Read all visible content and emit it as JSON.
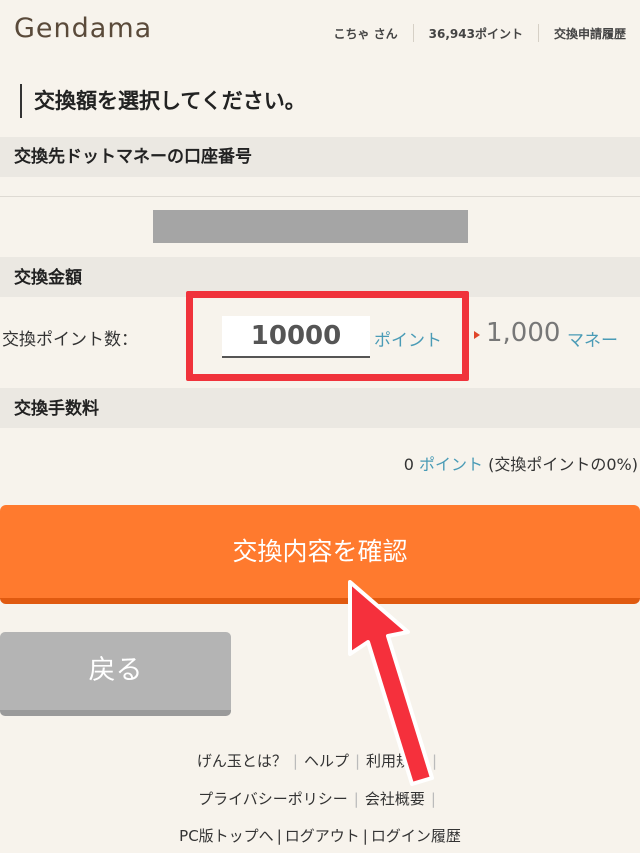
{
  "header": {
    "logo": "Gendama",
    "user": "こちゃ さん",
    "points": "36,943ポイント",
    "history_link": "交換申請履歴"
  },
  "page_title": "交換額を選択してください。",
  "sections": {
    "account": {
      "title": "交換先ドットマネーの口座番号"
    },
    "amount": {
      "title": "交換金額",
      "points_label": "交換ポイント数：",
      "points_value": "10000",
      "points_unit": "ポイント",
      "money_value": "1,000",
      "money_unit": "マネー"
    },
    "fee": {
      "title": "交換手数料",
      "fee_value": "0",
      "fee_unit": "ポイント",
      "fee_note": "(交換ポイントの0%)"
    }
  },
  "buttons": {
    "confirm": "交換内容を確認",
    "back": "戻る"
  },
  "footer": {
    "about": "げん玉とは？",
    "help": "ヘルプ",
    "terms": "利用規約",
    "privacy": "プライバシーポリシー",
    "company": "会社概要",
    "pc_top": "PC版トップへ",
    "logout": "ログアウト",
    "login_history": "ログイン履歴"
  },
  "colors": {
    "background": "#f7f3ec",
    "section_header": "#ebe8e2",
    "accent_orange": "#ff7a2e",
    "link_blue": "#4a9bb6",
    "highlight_red": "#f0323b",
    "back_gray": "#b4b4b4"
  }
}
